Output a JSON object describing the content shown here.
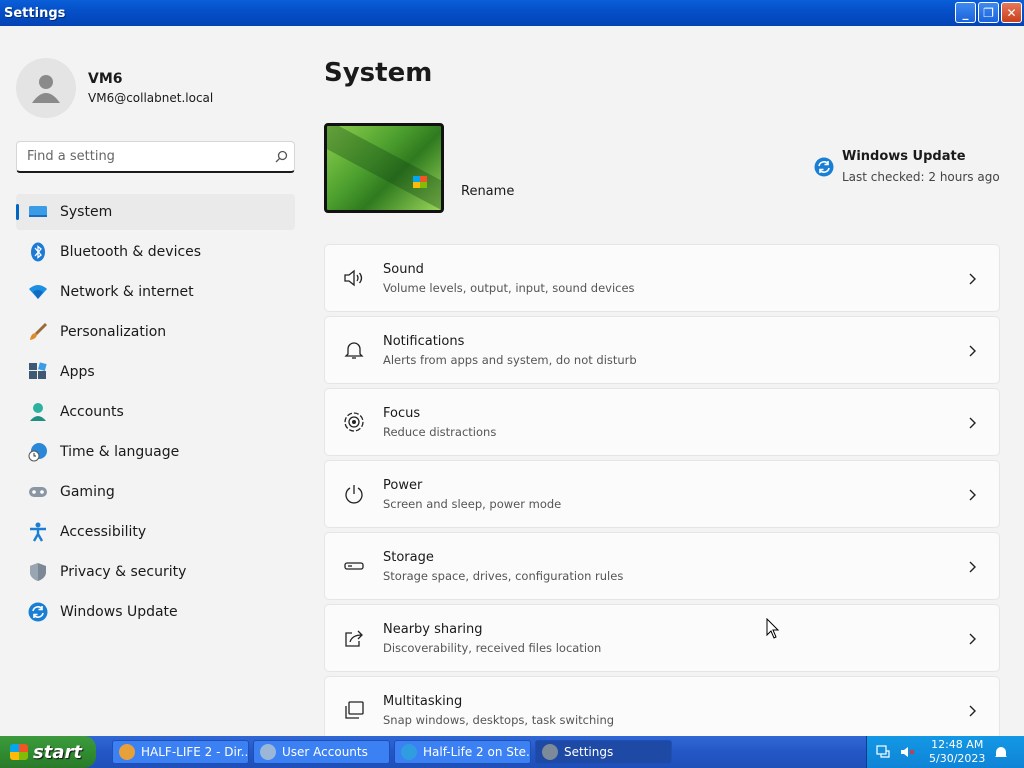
{
  "window": {
    "title": "Settings"
  },
  "profile": {
    "name": "VM6",
    "email": "VM6@collabnet.local"
  },
  "search": {
    "placeholder": "Find a setting"
  },
  "sidebar": {
    "items": [
      {
        "label": "System",
        "icon": "monitor-icon",
        "active": true
      },
      {
        "label": "Bluetooth & devices",
        "icon": "bluetooth-icon"
      },
      {
        "label": "Network & internet",
        "icon": "wifi-icon"
      },
      {
        "label": "Personalization",
        "icon": "brush-icon"
      },
      {
        "label": "Apps",
        "icon": "apps-icon"
      },
      {
        "label": "Accounts",
        "icon": "person-icon"
      },
      {
        "label": "Time & language",
        "icon": "globe-clock-icon"
      },
      {
        "label": "Gaming",
        "icon": "gamepad-icon"
      },
      {
        "label": "Accessibility",
        "icon": "accessibility-icon"
      },
      {
        "label": "Privacy & security",
        "icon": "shield-icon"
      },
      {
        "label": "Windows Update",
        "icon": "update-icon"
      }
    ]
  },
  "main": {
    "title": "System",
    "rename": "Rename",
    "update": {
      "title": "Windows Update",
      "status": "Last checked: 2 hours ago"
    },
    "cards": [
      {
        "title": "Sound",
        "subtitle": "Volume levels, output, input, sound devices",
        "icon": "speaker-icon"
      },
      {
        "title": "Notifications",
        "subtitle": "Alerts from apps and system, do not disturb",
        "icon": "bell-icon"
      },
      {
        "title": "Focus",
        "subtitle": "Reduce distractions",
        "icon": "focus-icon"
      },
      {
        "title": "Power",
        "subtitle": "Screen and sleep, power mode",
        "icon": "power-icon"
      },
      {
        "title": "Storage",
        "subtitle": "Storage space, drives, configuration rules",
        "icon": "storage-icon"
      },
      {
        "title": "Nearby sharing",
        "subtitle": "Discoverability, received files location",
        "icon": "share-icon"
      },
      {
        "title": "Multitasking",
        "subtitle": "Snap windows, desktops, task switching",
        "icon": "multitask-icon"
      }
    ]
  },
  "taskbar": {
    "start": "start",
    "tasks": [
      {
        "label": "HALF-LIFE 2 - Dir...",
        "color": "#e8a13a"
      },
      {
        "label": "User Accounts",
        "color": "#9bb7d8"
      },
      {
        "label": "Half-Life 2 on Ste...",
        "color": "#2f9de0"
      },
      {
        "label": "Settings",
        "color": "#7d8a99",
        "active": true
      }
    ],
    "time": "12:48 AM",
    "date": "5/30/2023"
  },
  "colors": {
    "accent": "#0067c0",
    "xp_blue": "#0550c9",
    "start_green": "#2f8a2f"
  }
}
